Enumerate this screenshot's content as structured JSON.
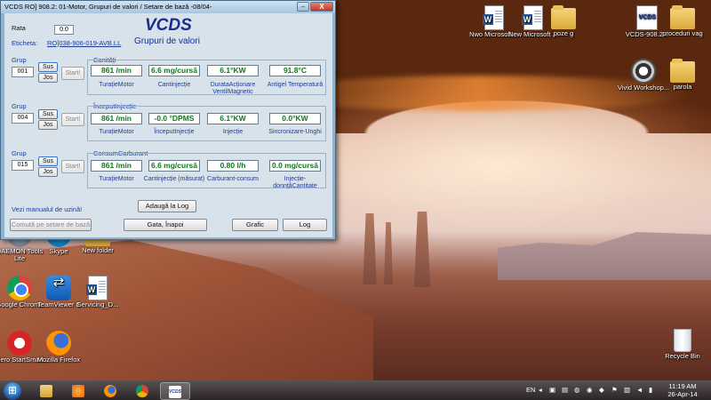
{
  "window": {
    "title": "VCDS RO] 908.2: 01-Motor,  Grupuri de valori / Setare de bază -08/04-",
    "minimize_label": "–",
    "close_label": "X"
  },
  "vcds": {
    "brand": "VCDS",
    "subtitle": "Grupuri de valori",
    "rate_label": "Rata",
    "rate_value": "0.0",
    "label_label": "Eticheta:",
    "label_value": "RO]038-906-019-AVB.LL"
  },
  "groups": [
    {
      "grup_label": "Grup",
      "number": "001",
      "up_label": "Sus",
      "down_label": "Jos",
      "start_label": "Start!",
      "title": "Canități",
      "fields": [
        {
          "value": "861 /min",
          "label": "TurațieMotor"
        },
        {
          "value": "6.6 mg/cursă",
          "label": "Cantinjecție"
        },
        {
          "value": "6.1°KW",
          "label": "DurataAcționare VentilMagnetic"
        },
        {
          "value": "91.8°C",
          "label": "Antigel Temperatură"
        }
      ]
    },
    {
      "grup_label": "Grup",
      "number": "004",
      "up_label": "Sus",
      "down_label": "Jos",
      "start_label": "Start!",
      "title": "ÎnceputInjecție",
      "fields": [
        {
          "value": "861 /min",
          "label": "TurațieMotor"
        },
        {
          "value": "-0.0 °DPMS",
          "label": "ÎnceputInjecție"
        },
        {
          "value": "6.1°KW",
          "label": "Injecție"
        },
        {
          "value": "0.0°KW",
          "label": "Sincronizare-Unghi"
        }
      ]
    },
    {
      "grup_label": "Grup",
      "number": "015",
      "up_label": "Sus",
      "down_label": "Jos",
      "start_label": "Start!",
      "title": "ConsumCarburant",
      "fields": [
        {
          "value": "861 /min",
          "label": "TurațieMotor"
        },
        {
          "value": "6.6 mg/cursă",
          "label": "Cantinjecție (măsurat)"
        },
        {
          "value": "0.80 l/h",
          "label": "Carburant-consum"
        },
        {
          "value": "0.0 mg/cursă",
          "label": "Injecție-donnțăCantitate"
        }
      ]
    }
  ],
  "footer": {
    "manual_link": "Vezi manualul de uzină!",
    "log_add_label": "Adaugă la Log",
    "basic_setting_label": "Comută pe setare de bază",
    "done_back_label": "Gata, Înapoi",
    "graph_label": "Grafic",
    "log_label": "Log"
  },
  "desktop_icons": [
    {
      "label": "Nwo Microsoft ...",
      "icon": "word-doc-icon"
    },
    {
      "label": "New Microsoft ...",
      "icon": "word-doc-icon"
    },
    {
      "label": "poze g",
      "icon": "folder-icon"
    },
    {
      "label": "VCDS-908.2...",
      "icon": "vcds-icon"
    },
    {
      "label": "proceduri vag",
      "icon": "folder-icon"
    },
    {
      "label": "Vivid Workshop...",
      "icon": "vivid-icon"
    },
    {
      "label": "parola",
      "icon": "folder-icon"
    },
    {
      "label": "DAEMON Tools Lite",
      "icon": "daemon-icon"
    },
    {
      "label": "Skype",
      "icon": "skype-icon"
    },
    {
      "label": "New folder",
      "icon": "folder-icon"
    },
    {
      "label": "Google Chrome",
      "icon": "chrome-icon"
    },
    {
      "label": "TeamViewer 8",
      "icon": "teamviewer-icon"
    },
    {
      "label": "Servicing_D...",
      "icon": "word-doc-icon"
    },
    {
      "label": "Nero StartSmart",
      "icon": "nero-icon"
    },
    {
      "label": "Mozilla Firefox",
      "icon": "firefox-icon"
    },
    {
      "label": "Recycle Bin",
      "icon": "recycle-bin-icon"
    }
  ],
  "taskbar": {
    "language": "EN",
    "time": "11:19 AM",
    "date": "26-Apr-14",
    "pinned": [
      "explorer-icon",
      "media-player-icon",
      "firefox-icon",
      "chrome-icon",
      "vcds-icon"
    ]
  }
}
